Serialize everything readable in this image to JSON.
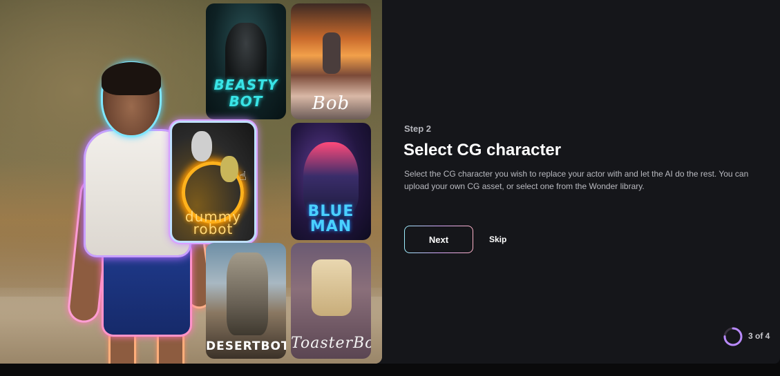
{
  "cards": [
    {
      "id": "beasty",
      "title": "BEASTY BOT"
    },
    {
      "id": "bob",
      "title": "Bob"
    },
    {
      "id": "dummy",
      "title": "dummy robot"
    },
    {
      "id": "blue",
      "title": "BLUE MAN"
    },
    {
      "id": "desert",
      "title": "DESERTBOT"
    },
    {
      "id": "toaster",
      "title": "ToasterBot"
    }
  ],
  "onboarding": {
    "step": "Step 2",
    "title": "Select CG character",
    "description": "Select the CG character you wish to replace your actor with and let the AI do the rest. You can upload your own CG asset, or select one from the Wonder library.",
    "next_label": "Next",
    "skip_label": "Skip",
    "progress_text": "3 of 4",
    "progress_fraction": 0.75
  },
  "colors": {
    "accent_gradient": [
      "#9ef0ff",
      "#d9a8ff",
      "#ffb3c8"
    ],
    "progress_ring": "#b98aff",
    "panel_bg": "#15161a"
  }
}
